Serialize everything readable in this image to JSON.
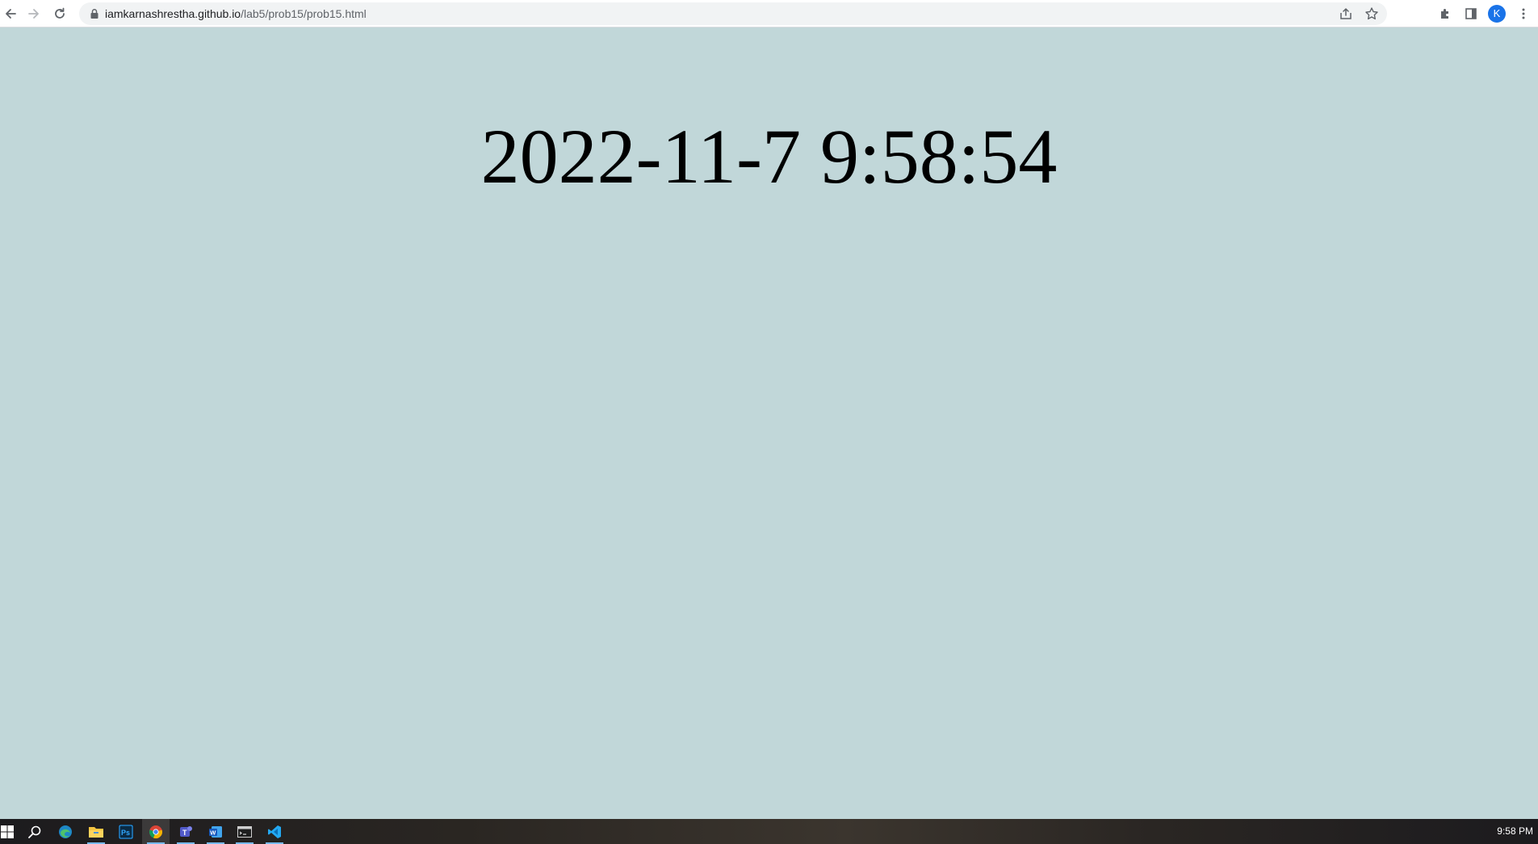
{
  "browser": {
    "url_host": "iamkarnashrestha.github.io",
    "url_path": "/lab5/prob15/prob15.html",
    "profile_initial": "K",
    "icons": {
      "back": "arrow-left-icon",
      "forward": "arrow-right-icon",
      "reload": "reload-icon",
      "lock": "lock-icon",
      "share": "share-icon",
      "bookmark": "star-icon",
      "extensions": "puzzle-icon",
      "side_panel": "side-panel-icon",
      "menu": "kebab-menu-icon"
    }
  },
  "page": {
    "background": "#c1d7d9",
    "clock_text": "2022-11-7 9:58:54"
  },
  "taskbar": {
    "apps": [
      "start",
      "search",
      "edge",
      "file-explorer",
      "photoshop",
      "chrome",
      "teams",
      "word",
      "terminal",
      "vscode"
    ],
    "active_app": "chrome",
    "clock": "9:58 PM"
  }
}
